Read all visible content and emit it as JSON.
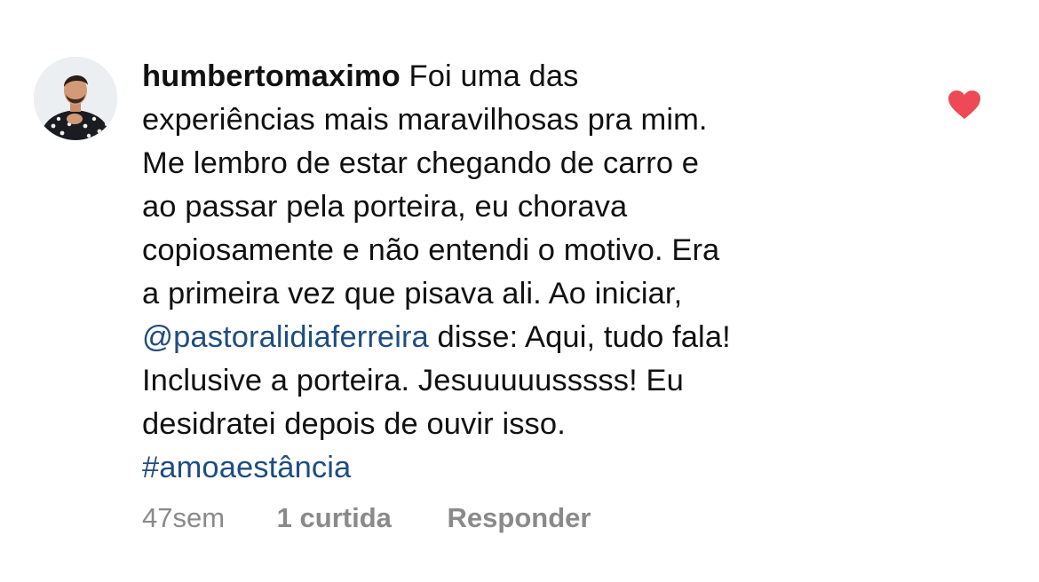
{
  "comment": {
    "username": "humbertomaximo",
    "lines": [
      " Foi uma das",
      "experiências mais maravilhosas pra mim.",
      "Me lembro de estar chegando de carro e",
      "ao passar pela porteira, eu chorava",
      "copiosamente e não entendi o motivo. Era",
      "a primeira vez que pisava ali. Ao iniciar,",
      " disse: Aqui, tudo fala!",
      "Inclusive a porteira. Jesuuuuusssss! Eu",
      "desidratei depois de ouvir isso."
    ],
    "mention": "@pastoralidiaferreira",
    "hashtag": "#amoaestância",
    "like_icon": "heart-filled-icon",
    "like_color": "#ed4956",
    "mention_color": "#1f4d80",
    "meta": {
      "time": "47sem",
      "likes": "1 curtida",
      "reply": "Responder"
    }
  }
}
